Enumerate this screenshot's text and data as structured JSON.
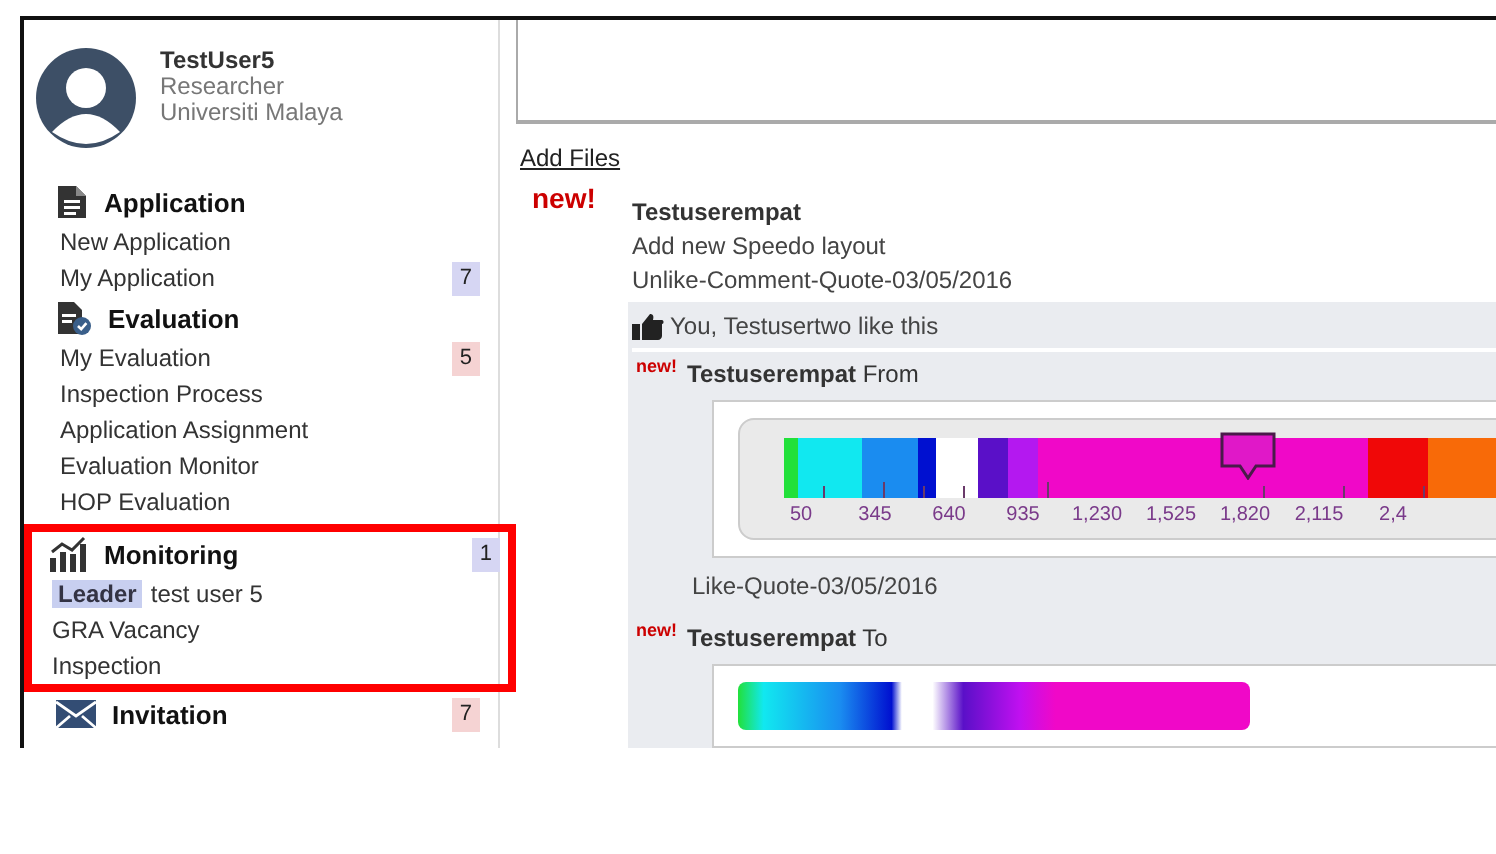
{
  "user": {
    "name": "TestUser5",
    "role": "Researcher",
    "organization": "Universiti Malaya"
  },
  "sidebar": {
    "sections": [
      {
        "title": "Application",
        "highlighted": false,
        "items": [
          {
            "label": "New Application"
          },
          {
            "label": "My Application",
            "badge": {
              "text": "7",
              "color": "#d6d6f3"
            }
          }
        ]
      },
      {
        "title": "Evaluation",
        "highlighted": false,
        "items": [
          {
            "label": "My Evaluation",
            "badge": {
              "text": "5",
              "color": "#f5d3d3"
            }
          },
          {
            "label": "Inspection Process"
          },
          {
            "label": "Application Assignment"
          },
          {
            "label": "Evaluation Monitor"
          },
          {
            "label": "HOP Evaluation"
          }
        ]
      },
      {
        "title": "Monitoring",
        "highlighted": true,
        "badge": {
          "text": "1",
          "color": "#d6d6f3"
        },
        "items": [
          {
            "label": "test user 5",
            "tag": "Leader"
          },
          {
            "label": "GRA Vacancy"
          },
          {
            "label": "Inspection"
          }
        ]
      },
      {
        "title": "Invitation",
        "highlighted": false,
        "badge": {
          "text": "7",
          "color": "#f5d3d3"
        }
      }
    ]
  },
  "main": {
    "add_files": "Add Files",
    "post": {
      "new_badge": "new!",
      "author": "Testuserempat",
      "text": "Add new Speedo layout",
      "actions": "Unlike-Comment-Quote-03/05/2016",
      "likes": "You, Testusertwo like this",
      "comments": [
        {
          "new_badge": "new!",
          "heading": "**Testuserempat** From",
          "scale_labels": [
            "50",
            "345",
            "640",
            "935",
            "1,230",
            "1,525",
            "1,820",
            "2,115",
            "2,4"
          ],
          "footer": "Like-Quote-03/05/2016"
        },
        {
          "new_badge": "new!",
          "heading": "**Testuserempat** To"
        }
      ]
    }
  }
}
